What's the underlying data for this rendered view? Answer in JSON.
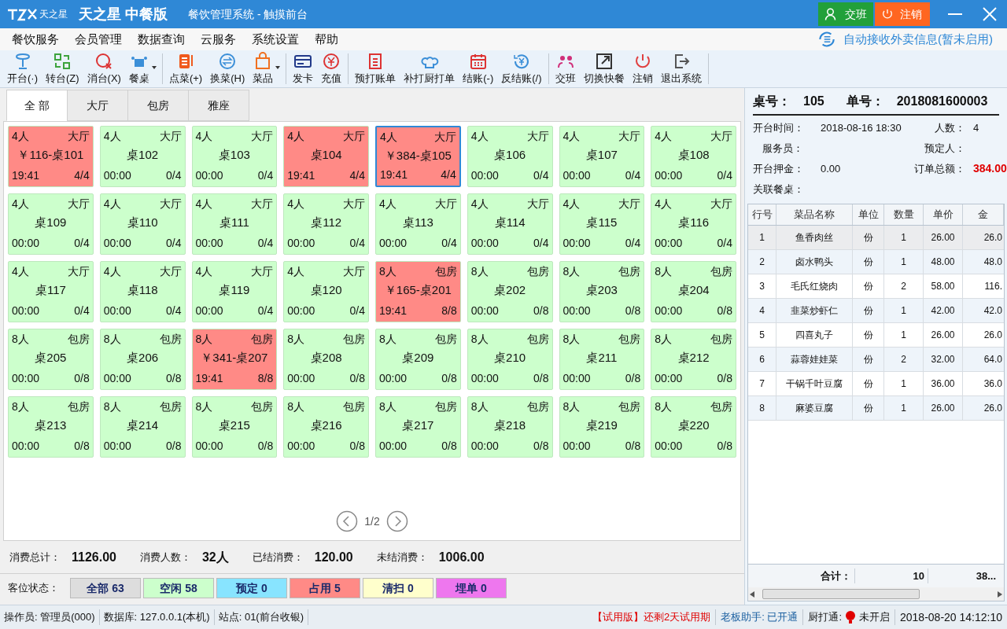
{
  "window": {
    "logo": "天之星",
    "product": "天之星 中餐版",
    "title": "餐饮管理系统 - 触摸前台",
    "buttons": [
      {
        "kind": "shift",
        "label": "交班"
      },
      {
        "kind": "logout",
        "label": "注销"
      }
    ]
  },
  "menu": [
    "餐饮服务",
    "会员管理",
    "数据查询",
    "云服务",
    "系统设置",
    "帮助"
  ],
  "takeaway_notice": "自动接收外卖信息(暂未启用)",
  "toolbar": [
    [
      {
        "label": "开台(·)",
        "dropdown": false
      },
      {
        "label": "转台(Z)",
        "dropdown": false
      },
      {
        "label": "消台(X)",
        "dropdown": false
      },
      {
        "label": "餐桌",
        "dropdown": true
      }
    ],
    [
      {
        "label": "点菜(+)",
        "dropdown": false
      },
      {
        "label": "换菜(H)",
        "dropdown": false
      },
      {
        "label": "菜品",
        "dropdown": true
      }
    ],
    [
      {
        "label": "发卡",
        "dropdown": false
      },
      {
        "label": "充值",
        "dropdown": false
      }
    ],
    [
      {
        "label": "预打账单",
        "dropdown": false
      },
      {
        "label": "补打厨打单",
        "dropdown": false
      },
      {
        "label": "结账(-)",
        "dropdown": false
      },
      {
        "label": "反结账(/)",
        "dropdown": false
      }
    ],
    [
      {
        "label": "交班",
        "dropdown": false
      },
      {
        "label": "切换快餐",
        "dropdown": false
      },
      {
        "label": "注销",
        "dropdown": false
      },
      {
        "label": "退出系统",
        "dropdown": false
      }
    ]
  ],
  "tabs": [
    {
      "label": "全 部",
      "selected": true
    },
    {
      "label": "大厅",
      "selected": false
    },
    {
      "label": "包房",
      "selected": false
    },
    {
      "label": "雅座",
      "selected": false
    }
  ],
  "tables": [
    {
      "seats": "4人",
      "area": "大厅",
      "name": "￥116-桌101",
      "time": "19:41",
      "occupancy": "4/4",
      "kind": "occupied",
      "selected": false
    },
    {
      "seats": "4人",
      "area": "大厅",
      "name": "桌102",
      "time": "00:00",
      "occupancy": "0/4",
      "kind": "free",
      "selected": false
    },
    {
      "seats": "4人",
      "area": "大厅",
      "name": "桌103",
      "time": "00:00",
      "occupancy": "0/4",
      "kind": "free",
      "selected": false
    },
    {
      "seats": "4人",
      "area": "大厅",
      "name": "桌104",
      "time": "19:41",
      "occupancy": "4/4",
      "kind": "occupied",
      "selected": false
    },
    {
      "seats": "4人",
      "area": "大厅",
      "name": "￥384-桌105",
      "time": "19:41",
      "occupancy": "4/4",
      "kind": "occupied",
      "selected": true
    },
    {
      "seats": "4人",
      "area": "大厅",
      "name": "桌106",
      "time": "00:00",
      "occupancy": "0/4",
      "kind": "free",
      "selected": false
    },
    {
      "seats": "4人",
      "area": "大厅",
      "name": "桌107",
      "time": "00:00",
      "occupancy": "0/4",
      "kind": "free",
      "selected": false
    },
    {
      "seats": "4人",
      "area": "大厅",
      "name": "桌108",
      "time": "00:00",
      "occupancy": "0/4",
      "kind": "free",
      "selected": false
    },
    {
      "seats": "4人",
      "area": "大厅",
      "name": "桌109",
      "time": "00:00",
      "occupancy": "0/4",
      "kind": "free",
      "selected": false
    },
    {
      "seats": "4人",
      "area": "大厅",
      "name": "桌110",
      "time": "00:00",
      "occupancy": "0/4",
      "kind": "free",
      "selected": false
    },
    {
      "seats": "4人",
      "area": "大厅",
      "name": "桌111",
      "time": "00:00",
      "occupancy": "0/4",
      "kind": "free",
      "selected": false
    },
    {
      "seats": "4人",
      "area": "大厅",
      "name": "桌112",
      "time": "00:00",
      "occupancy": "0/4",
      "kind": "free",
      "selected": false
    },
    {
      "seats": "4人",
      "area": "大厅",
      "name": "桌113",
      "time": "00:00",
      "occupancy": "0/4",
      "kind": "free",
      "selected": false
    },
    {
      "seats": "4人",
      "area": "大厅",
      "name": "桌114",
      "time": "00:00",
      "occupancy": "0/4",
      "kind": "free",
      "selected": false
    },
    {
      "seats": "4人",
      "area": "大厅",
      "name": "桌115",
      "time": "00:00",
      "occupancy": "0/4",
      "kind": "free",
      "selected": false
    },
    {
      "seats": "4人",
      "area": "大厅",
      "name": "桌116",
      "time": "00:00",
      "occupancy": "0/4",
      "kind": "free",
      "selected": false
    },
    {
      "seats": "4人",
      "area": "大厅",
      "name": "桌117",
      "time": "00:00",
      "occupancy": "0/4",
      "kind": "free",
      "selected": false
    },
    {
      "seats": "4人",
      "area": "大厅",
      "name": "桌118",
      "time": "00:00",
      "occupancy": "0/4",
      "kind": "free",
      "selected": false
    },
    {
      "seats": "4人",
      "area": "大厅",
      "name": "桌119",
      "time": "00:00",
      "occupancy": "0/4",
      "kind": "free",
      "selected": false
    },
    {
      "seats": "4人",
      "area": "大厅",
      "name": "桌120",
      "time": "00:00",
      "occupancy": "0/4",
      "kind": "free",
      "selected": false
    },
    {
      "seats": "8人",
      "area": "包房",
      "name": "￥165-桌201",
      "time": "19:41",
      "occupancy": "8/8",
      "kind": "occupied",
      "selected": false
    },
    {
      "seats": "8人",
      "area": "包房",
      "name": "桌202",
      "time": "00:00",
      "occupancy": "0/8",
      "kind": "free",
      "selected": false
    },
    {
      "seats": "8人",
      "area": "包房",
      "name": "桌203",
      "time": "00:00",
      "occupancy": "0/8",
      "kind": "free",
      "selected": false
    },
    {
      "seats": "8人",
      "area": "包房",
      "name": "桌204",
      "time": "00:00",
      "occupancy": "0/8",
      "kind": "free",
      "selected": false
    },
    {
      "seats": "8人",
      "area": "包房",
      "name": "桌205",
      "time": "00:00",
      "occupancy": "0/8",
      "kind": "free",
      "selected": false
    },
    {
      "seats": "8人",
      "area": "包房",
      "name": "桌206",
      "time": "00:00",
      "occupancy": "0/8",
      "kind": "free",
      "selected": false
    },
    {
      "seats": "8人",
      "area": "包房",
      "name": "￥341-桌207",
      "time": "19:41",
      "occupancy": "8/8",
      "kind": "occupied",
      "selected": false
    },
    {
      "seats": "8人",
      "area": "包房",
      "name": "桌208",
      "time": "00:00",
      "occupancy": "0/8",
      "kind": "free",
      "selected": false
    },
    {
      "seats": "8人",
      "area": "包房",
      "name": "桌209",
      "time": "00:00",
      "occupancy": "0/8",
      "kind": "free",
      "selected": false
    },
    {
      "seats": "8人",
      "area": "包房",
      "name": "桌210",
      "time": "00:00",
      "occupancy": "0/8",
      "kind": "free",
      "selected": false
    },
    {
      "seats": "8人",
      "area": "包房",
      "name": "桌211",
      "time": "00:00",
      "occupancy": "0/8",
      "kind": "free",
      "selected": false
    },
    {
      "seats": "8人",
      "area": "包房",
      "name": "桌212",
      "time": "00:00",
      "occupancy": "0/8",
      "kind": "free",
      "selected": false
    },
    {
      "seats": "8人",
      "area": "包房",
      "name": "桌213",
      "time": "00:00",
      "occupancy": "0/8",
      "kind": "free",
      "selected": false
    },
    {
      "seats": "8人",
      "area": "包房",
      "name": "桌214",
      "time": "00:00",
      "occupancy": "0/8",
      "kind": "free",
      "selected": false
    },
    {
      "seats": "8人",
      "area": "包房",
      "name": "桌215",
      "time": "00:00",
      "occupancy": "0/8",
      "kind": "free",
      "selected": false
    },
    {
      "seats": "8人",
      "area": "包房",
      "name": "桌216",
      "time": "00:00",
      "occupancy": "0/8",
      "kind": "free",
      "selected": false
    },
    {
      "seats": "8人",
      "area": "包房",
      "name": "桌217",
      "time": "00:00",
      "occupancy": "0/8",
      "kind": "free",
      "selected": false
    },
    {
      "seats": "8人",
      "area": "包房",
      "name": "桌218",
      "time": "00:00",
      "occupancy": "0/8",
      "kind": "free",
      "selected": false
    },
    {
      "seats": "8人",
      "area": "包房",
      "name": "桌219",
      "time": "00:00",
      "occupancy": "0/8",
      "kind": "free",
      "selected": false
    },
    {
      "seats": "8人",
      "area": "包房",
      "name": "桌220",
      "time": "00:00",
      "occupancy": "0/8",
      "kind": "free",
      "selected": false
    }
  ],
  "pager": "1/2",
  "summary": [
    {
      "label": "消费总计：",
      "value": "1126.00"
    },
    {
      "label": "消费人数：",
      "value": "32人"
    },
    {
      "label": "已结消费：",
      "value": "120.00"
    },
    {
      "label": "未结消费：",
      "value": "1006.00"
    }
  ],
  "status_filter": {
    "label": "客位状态：",
    "items": [
      {
        "label": "全部 63",
        "color": "#dddddd"
      },
      {
        "label": "空闲 58",
        "color": "#ccffcc"
      },
      {
        "label": "预定 0",
        "color": "#88e4ff"
      },
      {
        "label": "占用 5",
        "color": "#ff8a86"
      },
      {
        "label": "清扫 0",
        "color": "#ffffcc"
      },
      {
        "label": "埋单 0",
        "color": "#ee77ee"
      }
    ]
  },
  "order": {
    "table_label": "桌号：",
    "table": "105",
    "order_label": "单号：",
    "order_no": "2018081600003",
    "fields": [
      {
        "label": "开台时间：",
        "value": "2018-08-16 18:30"
      },
      {
        "label": "人数：",
        "value": "4"
      },
      {
        "label": "服务员："
      },
      {
        "label": "预定人："
      },
      {
        "label": "开台押金：",
        "value": "0.00"
      },
      {
        "label": "订单总额：",
        "value": "384.00",
        "kind": "total"
      },
      {
        "label": "关联餐桌："
      }
    ],
    "columns": [
      "行号",
      "菜品名称",
      "单位",
      "数量",
      "单价",
      "金"
    ],
    "rows": [
      {
        "cells": [
          "1",
          "鱼香肉丝",
          "份",
          "1",
          "26.00",
          "26.0"
        ],
        "selected": true
      },
      {
        "cells": [
          "2",
          "卤水鸭头",
          "份",
          "1",
          "48.00",
          "48.0"
        ],
        "selected": false
      },
      {
        "cells": [
          "3",
          "毛氏红烧肉",
          "份",
          "2",
          "58.00",
          "116."
        ],
        "selected": false
      },
      {
        "cells": [
          "4",
          "韭菜炒虾仁",
          "份",
          "1",
          "42.00",
          "42.0"
        ],
        "selected": false
      },
      {
        "cells": [
          "5",
          "四喜丸子",
          "份",
          "1",
          "26.00",
          "26.0"
        ],
        "selected": false
      },
      {
        "cells": [
          "6",
          "蒜蓉娃娃菜",
          "份",
          "2",
          "32.00",
          "64.0"
        ],
        "selected": false
      },
      {
        "cells": [
          "7",
          "干锅千叶豆腐",
          "份",
          "1",
          "36.00",
          "36.0"
        ],
        "selected": false
      },
      {
        "cells": [
          "8",
          "麻婆豆腐",
          "份",
          "1",
          "26.00",
          "26.0"
        ],
        "selected": false
      }
    ],
    "footer": [
      "合计：",
      "10",
      "38..."
    ]
  },
  "status_bar": {
    "left": [
      "操作员:  管理员(000)",
      "数据库: 127.0.0.1(本机)",
      "站点: 01(前台收银)"
    ],
    "trial": "【试用版】还剩2天试用期",
    "boss": "老板助手: 已开通",
    "kitchen_label": "厨打通:",
    "kitchen_on": false,
    "kitchen_state": "未开启",
    "datetime": "2018-08-20 14:12:10"
  }
}
